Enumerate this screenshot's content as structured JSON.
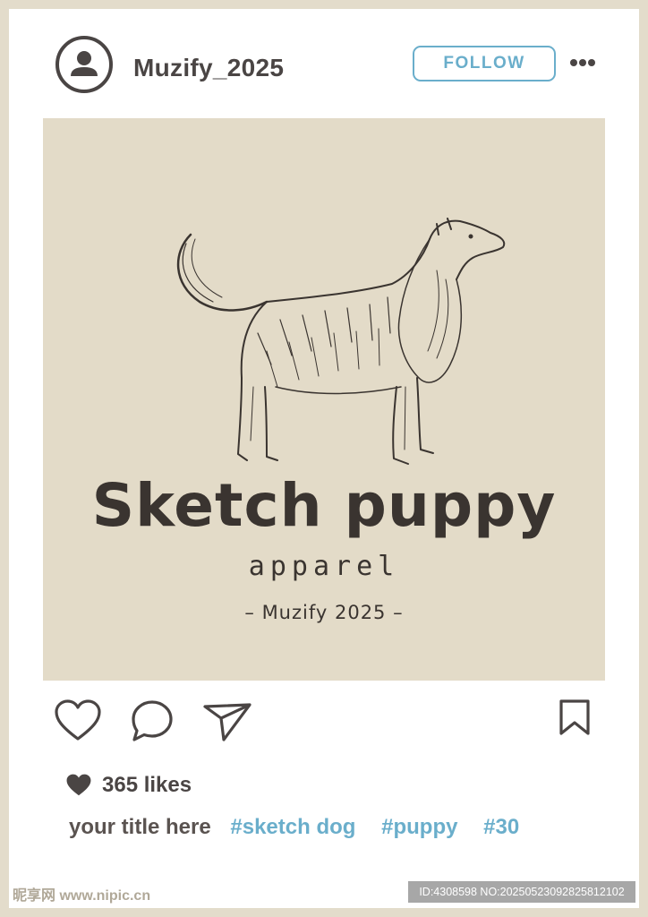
{
  "post": {
    "username": "Muzify_2025",
    "follow_label": "FOLLOW",
    "image": {
      "title": "Sketch puppy",
      "subtitle": "apparel",
      "tagline": "– Muzify 2025 –"
    },
    "likes_count": "365 likes",
    "caption_title": "your title here",
    "hashtags": [
      "#sketch dog",
      "#puppy",
      "#30"
    ]
  },
  "watermark": {
    "site": "昵享网 www.nipic.cn",
    "id_text": "ID:4308598 NO:20250523092825812102"
  },
  "colors": {
    "frame": "#e3dccb",
    "accent": "#6aaecb",
    "icon": "#4a4544",
    "image_bg": "#e3dbc8"
  },
  "icons": {
    "avatar": "user-avatar-icon",
    "more": "more-dots-icon",
    "like": "heart-outline-icon",
    "comment": "comment-bubble-icon",
    "share": "paper-plane-icon",
    "save": "bookmark-icon",
    "likes": "heart-filled-icon"
  }
}
